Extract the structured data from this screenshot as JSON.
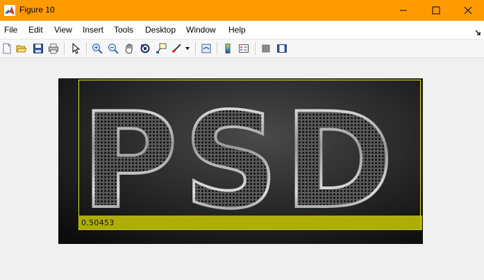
{
  "window": {
    "title": "Figure 10",
    "title_bar_color": "#ff9b00"
  },
  "menu": {
    "items": [
      "File",
      "Edit",
      "View",
      "Insert",
      "Tools",
      "Desktop",
      "Window",
      "Help"
    ]
  },
  "toolbar": {
    "icons": [
      "new-figure-icon",
      "open-file-icon",
      "save-icon",
      "print-icon",
      "select-arrow-icon",
      "zoom-in-icon",
      "zoom-out-icon",
      "pan-hand-icon",
      "rotate-3d-icon",
      "data-cursor-icon",
      "brush-icon",
      "brush-dropdown-icon",
      "link-plot-icon",
      "colorbar-icon",
      "legend-icon",
      "hide-plot-tools-icon",
      "show-plot-tools-icon"
    ]
  },
  "figure": {
    "image_text": "PSD",
    "roi_value": "0.50453",
    "roi_color": "#e7e61c"
  }
}
